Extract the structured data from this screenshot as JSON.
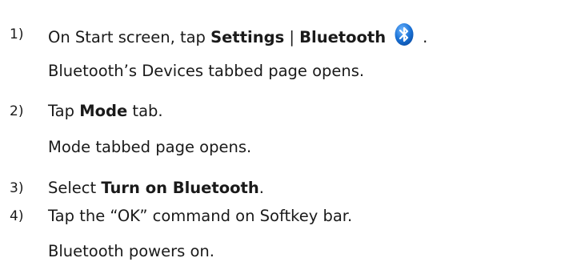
{
  "steps": [
    {
      "number": "1)",
      "pre": "On Start screen, tap ",
      "bold1": "Settings",
      "sep": " | ",
      "bold2": "Bluetooth",
      "icon": "bluetooth-icon",
      "post": ".",
      "result": "Bluetooth’s Devices tabbed page opens."
    },
    {
      "number": "2)",
      "pre": "Tap ",
      "bold": "Mode",
      "post": " tab.",
      "result": "Mode tabbed page opens."
    },
    {
      "number": "3)",
      "pre": "Select ",
      "bold": "Turn on Bluetooth",
      "post": "."
    },
    {
      "number": "4)",
      "text": "Tap the “OK” command on Softkey bar.",
      "result": "Bluetooth powers on."
    }
  ],
  "colors": {
    "bluetooth_blue": "#1a72d6",
    "text": "#1a1a1a"
  }
}
